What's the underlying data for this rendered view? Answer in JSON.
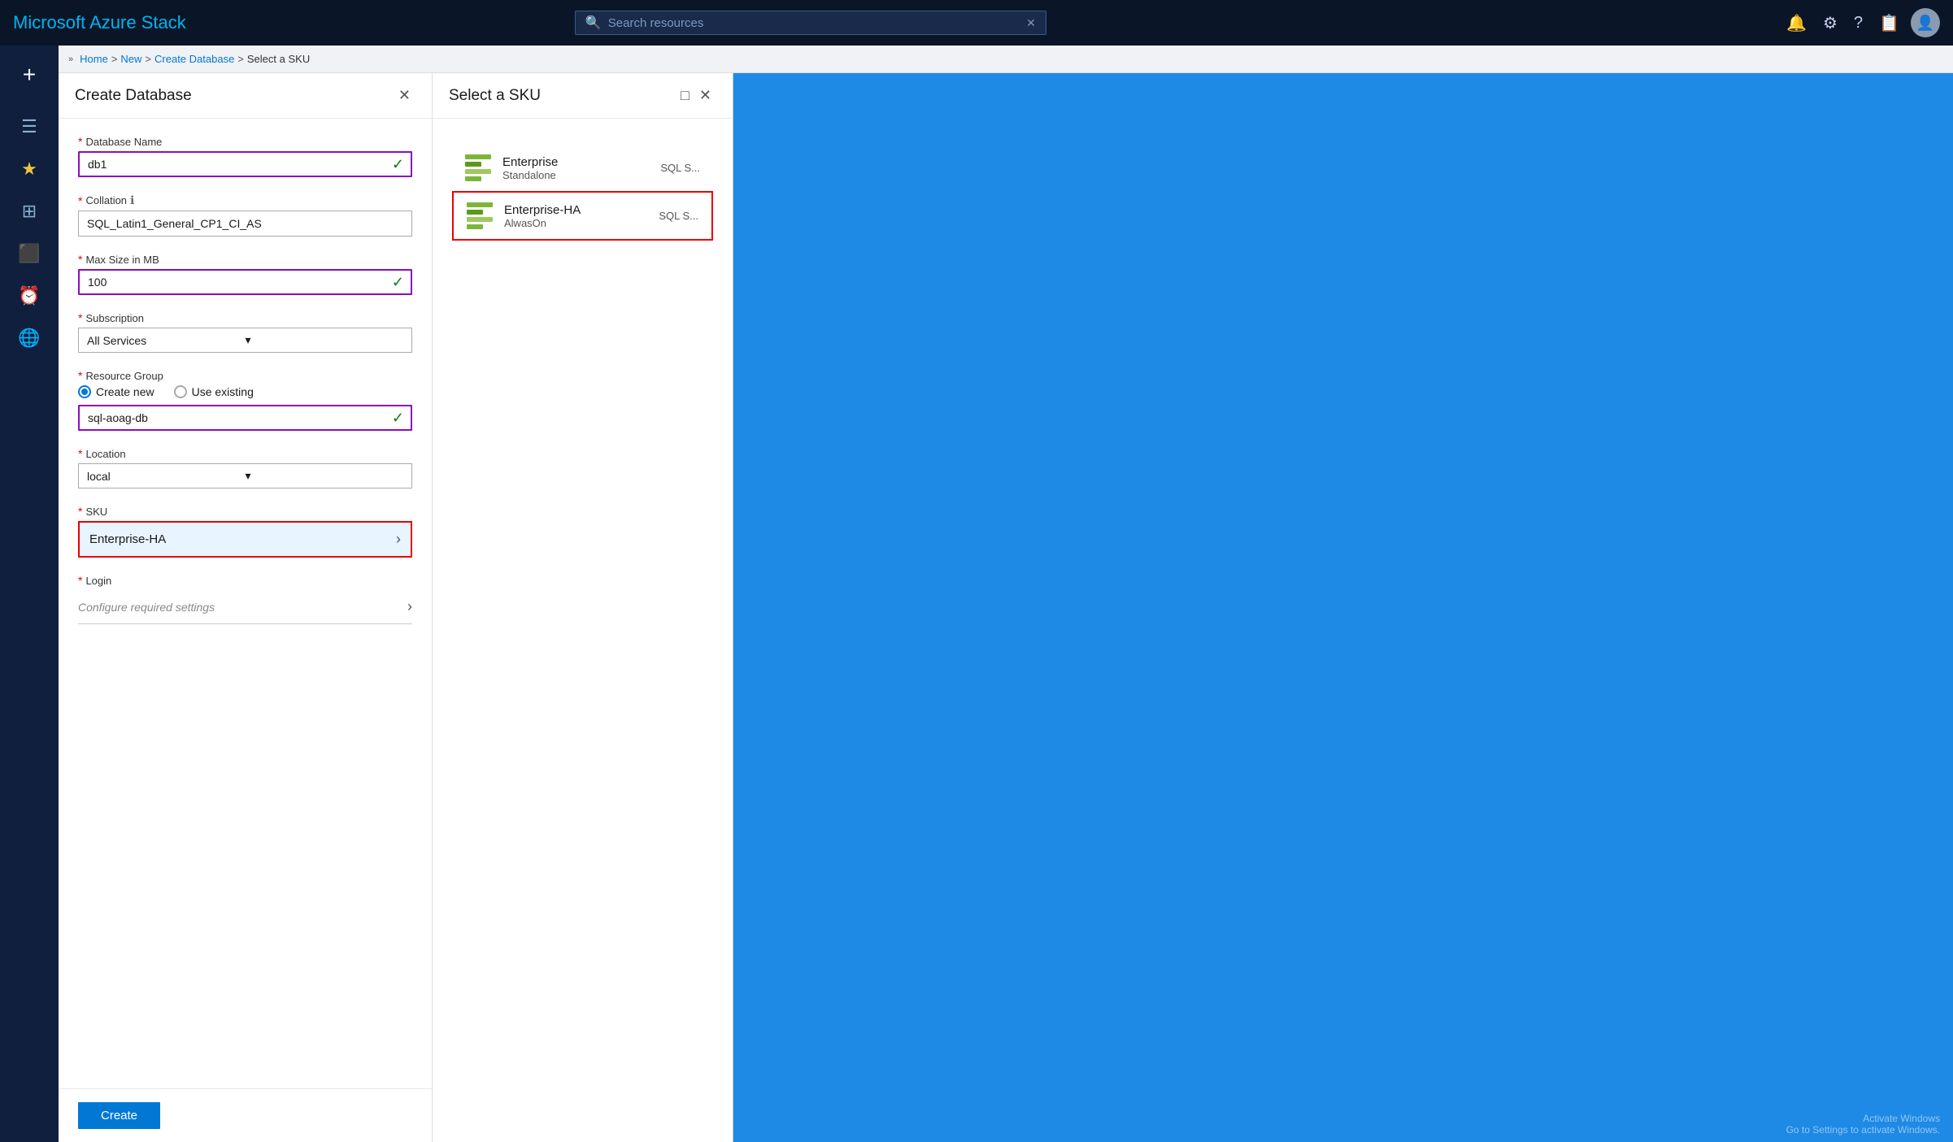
{
  "app": {
    "title": "Microsoft Azure Stack"
  },
  "topbar": {
    "search_placeholder": "Search resources",
    "close_icon": "✕"
  },
  "breadcrumb": {
    "items": [
      "Home",
      "New",
      "Create Database",
      "Select a SKU"
    ],
    "separator": ">"
  },
  "sidebar": {
    "add_label": "+",
    "items": [
      {
        "id": "menu",
        "icon": "☰",
        "label": "Menu"
      },
      {
        "id": "favorites",
        "icon": "★",
        "label": "Favorites"
      },
      {
        "id": "dashboard",
        "icon": "⊞",
        "label": "Dashboard"
      },
      {
        "id": "all-resources",
        "icon": "⬛",
        "label": "All resources"
      },
      {
        "id": "recent",
        "icon": "🕐",
        "label": "Recent"
      },
      {
        "id": "help",
        "icon": "🌐",
        "label": "Help"
      }
    ]
  },
  "create_panel": {
    "title": "Create Database",
    "close_icon": "✕",
    "fields": {
      "database_name": {
        "label": "Database Name",
        "required": true,
        "value": "db1",
        "has_check": true
      },
      "collation": {
        "label": "Collation",
        "required": true,
        "has_info": true,
        "value": "SQL_Latin1_General_CP1_CI_AS"
      },
      "max_size": {
        "label": "Max Size in MB",
        "required": true,
        "value": "100",
        "has_check": true
      },
      "subscription": {
        "label": "Subscription",
        "required": true,
        "value": "All Services",
        "is_dropdown": true
      },
      "resource_group": {
        "label": "Resource Group",
        "required": true,
        "options": [
          "Create new",
          "Use existing"
        ],
        "selected": "Create new",
        "value": "sql-aoag-db",
        "has_check": true
      },
      "location": {
        "label": "Location",
        "required": true,
        "value": "local",
        "is_dropdown": true
      },
      "sku": {
        "label": "SKU",
        "required": true,
        "value": "Enterprise-HA",
        "is_nav": true
      },
      "login": {
        "label": "Login",
        "required": true,
        "placeholder": "Configure required settings",
        "is_nav": true
      }
    },
    "create_button": "Create"
  },
  "sku_panel": {
    "title": "Select a SKU",
    "close_icon": "✕",
    "minimize_icon": "□",
    "items": [
      {
        "id": "enterprise",
        "name": "Enterprise",
        "sub": "Standalone",
        "type": "SQL S...",
        "selected": false
      },
      {
        "id": "enterprise-ha",
        "name": "Enterprise-HA",
        "sub": "AlwasOn",
        "type": "SQL S...",
        "selected": true
      }
    ]
  },
  "watermark": {
    "line1": "Activate Windows",
    "line2": "Go to Settings to activate Windows."
  }
}
